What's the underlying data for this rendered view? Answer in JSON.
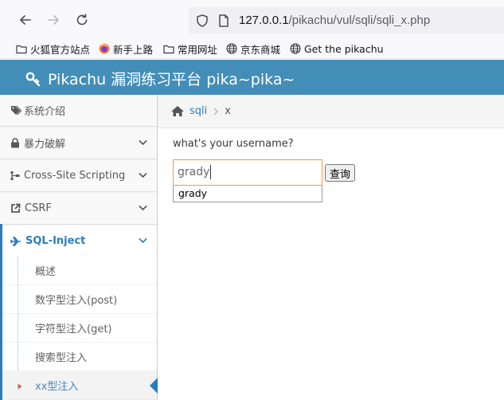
{
  "browser": {
    "url_host": "127.0.0.1",
    "url_path": "/pikachu/vul/sqli/sqli_x.php",
    "bookmarks": [
      {
        "label": "火狐官方站点",
        "icon": "folder-icon"
      },
      {
        "label": "新手上路",
        "icon": "firefox-icon"
      },
      {
        "label": "常用网址",
        "icon": "folder-icon"
      },
      {
        "label": "京东商城",
        "icon": "globe-icon"
      },
      {
        "label": "Get the pikachu",
        "icon": "globe-icon"
      }
    ]
  },
  "header": {
    "title": "Pikachu 漏洞练习平台 pika~pika~",
    "icon": "key-icon"
  },
  "sidebar": {
    "items": [
      {
        "label": "系统介绍",
        "icon": "tags-icon"
      },
      {
        "label": "暴力破解",
        "icon": "lock-icon"
      },
      {
        "label": "Cross-Site Scripting",
        "icon": "sitemap-icon"
      },
      {
        "label": "CSRF",
        "icon": "share-icon"
      },
      {
        "label": "SQL-Inject",
        "icon": "plane-icon"
      }
    ],
    "subitems": [
      {
        "label": "概述"
      },
      {
        "label": "数字型注入(post)"
      },
      {
        "label": "字符型注入(get)"
      },
      {
        "label": "搜索型注入"
      },
      {
        "label": "xx型注入"
      }
    ]
  },
  "breadcrumb": {
    "home": "sqli",
    "current": "x"
  },
  "main": {
    "prompt": "what's your username?",
    "input_value": "grady",
    "button_label": "查询",
    "autocomplete": [
      "grady"
    ]
  },
  "colors": {
    "header_bg": "#438eb9",
    "active": "#2b7dbc",
    "input_focus": "#f59942"
  }
}
